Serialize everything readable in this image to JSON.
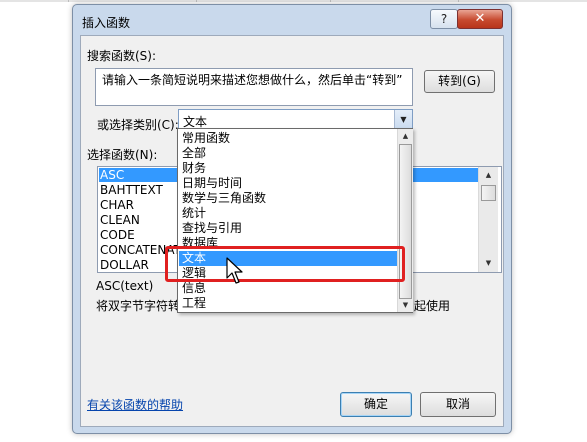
{
  "dialog": {
    "title": "插入函数",
    "help_glyph": "?",
    "close_glyph": "✕"
  },
  "search": {
    "label": "搜索函数(S):",
    "value": "请输入一条简短说明来描述您想做什么，然后单击“转到”",
    "go_button": "转到(G)"
  },
  "category": {
    "label": "或选择类别(C):",
    "value": "文本"
  },
  "function_list": {
    "label": "选择函数(N):",
    "items": [
      "ASC",
      "BAHTTEXT",
      "CHAR",
      "CLEAN",
      "CODE",
      "CONCATENATE",
      "DOLLAR"
    ],
    "selected": "ASC"
  },
  "category_dropdown": {
    "options": [
      "常用函数",
      "全部",
      "财务",
      "日期与时间",
      "数学与三角函数",
      "统计",
      "查找与引用",
      "数据库",
      "文本",
      "逻辑",
      "信息",
      "工程"
    ],
    "selected": "文本"
  },
  "description": {
    "signature": "ASC(text)",
    "text_left": "将双字节字符转",
    "text_right": "起使用"
  },
  "footer": {
    "help_link": "有关该函数的帮助",
    "ok_button": "确定",
    "cancel_button": "取消"
  },
  "colors": {
    "selection": "#3399ff",
    "highlight_box": "#e02020",
    "dialog_frame": "#c9d9ec"
  }
}
